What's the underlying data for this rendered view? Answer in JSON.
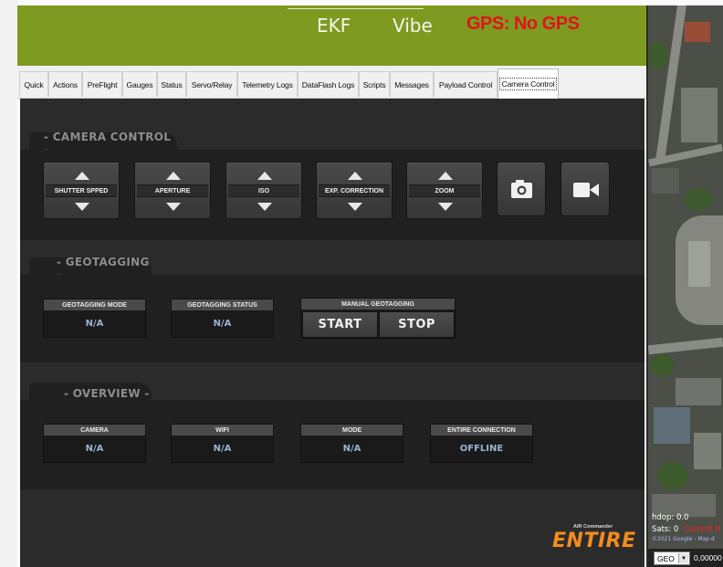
{
  "header": {
    "ekf_label": "EKF",
    "vibe_label": "Vibe",
    "gps_status": "GPS: No GPS",
    "background_color": "#7e9a20",
    "gps_color": "#e0141b"
  },
  "tabs": [
    {
      "label": "Quick"
    },
    {
      "label": "Actions"
    },
    {
      "label": "PreFlight"
    },
    {
      "label": "Gauges"
    },
    {
      "label": "Status"
    },
    {
      "label": "Servo/Relay"
    },
    {
      "label": "Telemetry Logs"
    },
    {
      "label": "DataFlash Logs"
    },
    {
      "label": "Scripts"
    },
    {
      "label": "Messages"
    },
    {
      "label": "Payload Control"
    },
    {
      "label": "Camera Control"
    }
  ],
  "active_tab": "Camera Control",
  "camera_control": {
    "section_title": "- CAMERA CONTROL -",
    "controls": [
      {
        "label": "SHUTTER SPPED"
      },
      {
        "label": "APERTURE"
      },
      {
        "label": "ISO"
      },
      {
        "label": "EXP. CORRECTION"
      },
      {
        "label": "ZOOM"
      }
    ],
    "photo_icon": "camera-icon",
    "video_icon": "video-camera-icon"
  },
  "geotagging": {
    "section_title": "- GEOTAGGING -",
    "mode": {
      "caption": "GEOTAGGING MODE",
      "value": "N/A"
    },
    "status": {
      "caption": "GEOTAGGING STATUS",
      "value": "N/A"
    },
    "manual": {
      "caption": "MANUAL GEOTAGGING",
      "start_label": "START",
      "stop_label": "STOP"
    }
  },
  "overview": {
    "section_title": "- OVERVIEW -",
    "items": [
      {
        "caption": "CAMERA",
        "value": "N/A"
      },
      {
        "caption": "WIFI",
        "value": "N/A"
      },
      {
        "caption": "MODE",
        "value": "N/A"
      },
      {
        "caption": "ENTIRE CONNECTION",
        "value": "OFFLINE"
      }
    ]
  },
  "logo": {
    "small_text": "AIR Commander",
    "brand_text": "ENTIRE",
    "color": "#f28c1c"
  },
  "map": {
    "hdop_text": "hdop: 0.0",
    "sats_text": "Sats: 0",
    "current_text": "Current H",
    "copyright_text": "©2021 Google - Map d",
    "coord_system": "GEO",
    "coord_value": "0,00000"
  }
}
